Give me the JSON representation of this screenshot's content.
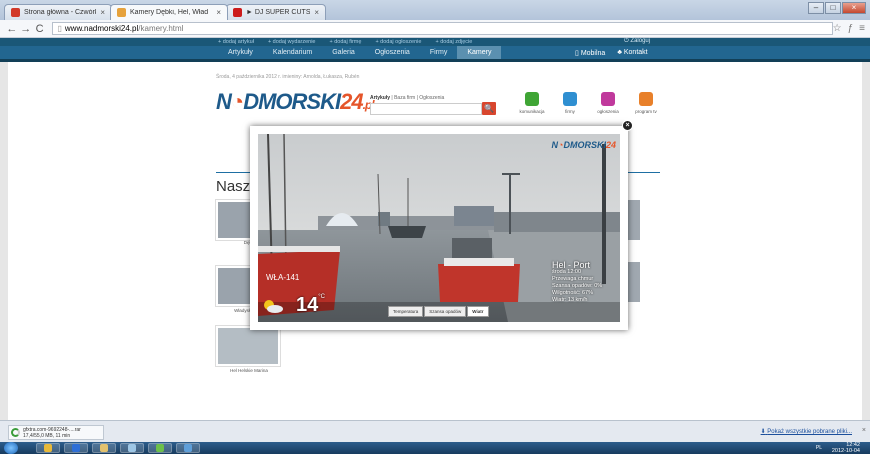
{
  "browser": {
    "tabs": [
      {
        "title": "Strona główna - Czwórki",
        "favicon_color": "#d23a2a"
      },
      {
        "title": "Kamery Dębki, Hel, Wład",
        "favicon_color": "#e6a23c",
        "active": true
      },
      {
        "title": "► DJ SUPER CUTS 2 - ",
        "favicon_color": "#cc1b1b"
      }
    ],
    "url_host": "www.nadmorski24.pl",
    "url_path": "/kamery.html",
    "back": "←",
    "forward": "→",
    "reload": "C"
  },
  "site": {
    "top_links": [
      "+ dodaj artykuł",
      "+ dodaj wydarzenie",
      "+ dodaj firmę",
      "+ dodaj ogłoszenie",
      "+ dodaj zdjęcie"
    ],
    "login": "Zaloguj",
    "nav": [
      "Artykuły",
      "Kalendarium",
      "Galeria",
      "Ogłoszenia",
      "Firmy",
      "Kamery"
    ],
    "nav_active": "Kamery",
    "mobile": "Mobilna",
    "contact": "Kontakt",
    "dateline": "Środa, 4 października 2012 r. imieniny: Arnolda, Łukasza, Rubén",
    "logo_left": "N",
    "logo_mid": "DMORSKI",
    "logo_num": "24",
    "logo_tld": ".pl",
    "search_tabs": {
      "active": "Artykuły",
      "others": "| Baza firm | Ogłoszenia"
    },
    "search_btn": "🔍",
    "categories": [
      {
        "label": "komunikacja",
        "color": "#3fa535"
      },
      {
        "label": "firmy",
        "color": "#2f8fd1"
      },
      {
        "label": "ogłoszenia",
        "color": "#c0399c"
      },
      {
        "label": "program tv",
        "color": "#e8802a"
      }
    ],
    "heading": "Nasz",
    "thumbs": [
      {
        "caption": "Dębk"
      },
      {
        "caption": "Władysł... Koła"
      },
      {
        "caption": "Hel Helskie Marina"
      }
    ]
  },
  "camera": {
    "watermark_mid": "DMORSKI",
    "watermark_num": "24",
    "temperature": "14",
    "unit": "°C",
    "location": "Hel - Port",
    "lines": [
      "środa 12:00",
      "Przewaga chmur",
      "Szansa opadów: 0%",
      "Wilgotność: 67%",
      "Wiatr: 13 km/h"
    ],
    "buttons": [
      "Temperatura",
      "Szansa opadów",
      "Wiatr"
    ],
    "active_button": "Wiatr",
    "boat_label": "WŁA-141"
  },
  "downloads": {
    "file": "gfxtra.com-9692248-....rar",
    "progress": "17,4/55,0 MB, 11 min",
    "show_all": "Pokaż wszystkie pobrane pliki...",
    "close": "×"
  },
  "taskbar": {
    "lang": "PL",
    "time": "12:42",
    "date": "2012-10-04"
  }
}
